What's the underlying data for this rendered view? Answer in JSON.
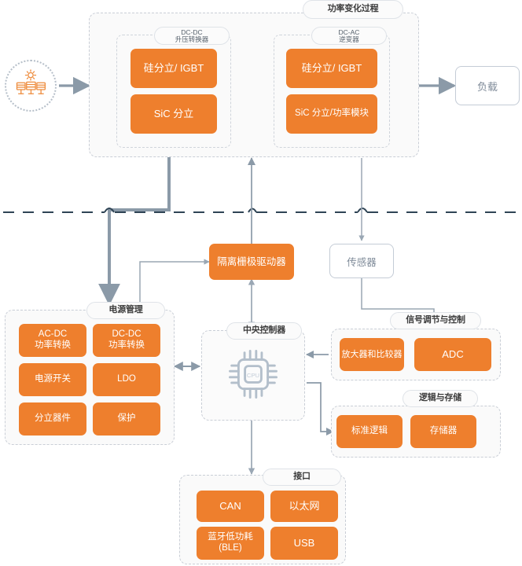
{
  "diagram": {
    "title": "功率变化过程",
    "colors": {
      "accent_orange": "#ee7f2d",
      "line_gray": "#8b9aa8",
      "isolation_dash": "#2f4455",
      "group_border": "#c9ced6",
      "text_gray": "#7f8b99"
    }
  },
  "source": {
    "icon": "solar-panel-icon",
    "label": ""
  },
  "power_stage": {
    "title": "功率变化过程",
    "dcdc": {
      "title": "DC-DC\n升压转换器",
      "blocks": [
        {
          "label": "硅分立/ IGBT"
        },
        {
          "label": "SiC 分立"
        }
      ]
    },
    "dcac": {
      "title": "DC-AC\n逆变器",
      "blocks": [
        {
          "label": "硅分立/ IGBT"
        },
        {
          "label": "SiC 分立/功率模块"
        }
      ]
    }
  },
  "load": {
    "label": "负载"
  },
  "gate_driver": {
    "label": "隔离栅极驱动器"
  },
  "sensor": {
    "label": "传感器"
  },
  "power_management": {
    "title": "电源管理",
    "blocks": [
      {
        "label": "AC-DC\n功率转换"
      },
      {
        "label": "DC-DC\n功率转换"
      },
      {
        "label": "电源开关"
      },
      {
        "label": "LDO"
      },
      {
        "label": "分立器件"
      },
      {
        "label": "保护"
      }
    ]
  },
  "controller": {
    "title": "中央控制器",
    "icon": "cpu-chip-icon",
    "icon_label": "CPU"
  },
  "signal_chain": {
    "title": "信号调节与控制",
    "blocks": [
      {
        "label": "放大器和比较器"
      },
      {
        "label": "ADC"
      }
    ]
  },
  "logic_memory": {
    "title": "逻辑与存储",
    "blocks": [
      {
        "label": "标准逻辑"
      },
      {
        "label": "存储器"
      }
    ]
  },
  "interface": {
    "title": "接口",
    "blocks": [
      {
        "label": "CAN"
      },
      {
        "label": "以太网"
      },
      {
        "label": "蓝牙低功耗\n(BLE)"
      },
      {
        "label": "USB"
      }
    ]
  }
}
